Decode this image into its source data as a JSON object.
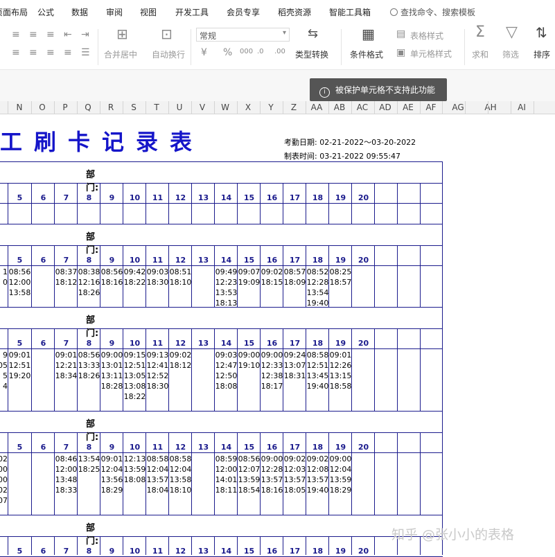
{
  "menu": [
    "页面布局",
    "公式",
    "数据",
    "审阅",
    "视图",
    "开发工具",
    "会员专享",
    "稻壳资源",
    "智能工具箱"
  ],
  "search_placeholder": "查找命令、搜索模板",
  "ribbon": {
    "merge_center": "合并居中",
    "auto_wrap": "自动换行",
    "number_format": "常规",
    "type_convert": "类型转换",
    "conditional_format": "条件格式",
    "table_style": "表格样式",
    "cell_style": "单元格样式",
    "sum": "求和",
    "filter": "筛选",
    "sort": "排序"
  },
  "toast": "被保护单元格不支持此功能",
  "columns": [
    "N",
    "O",
    "P",
    "Q",
    "R",
    "S",
    "T",
    "U",
    "V",
    "W",
    "X",
    "Y",
    "Z",
    "AA",
    "AB",
    "AC",
    "AD",
    "AE",
    "AF",
    "AG",
    "AH",
    "AI"
  ],
  "sheet": {
    "title": "工刷卡记录表",
    "period_label": "考勤日期:",
    "period_value": "02-21-2022～03-20-2022",
    "made_label": "制表时间:",
    "made_value": "03-21-2022 09:55:47",
    "dept_label": "部门:",
    "days": [
      "5",
      "6",
      "7",
      "8",
      "9",
      "10",
      "11",
      "12",
      "13",
      "14",
      "15",
      "16",
      "17",
      "18",
      "19",
      "20"
    ],
    "blocks": [
      {
        "cut": [],
        "cells": []
      },
      {
        "cut": [
          "1",
          "0"
        ],
        "cells": [
          [
            "08:56",
            "12:00",
            "13:58"
          ],
          [],
          [
            "08:37",
            "18:12"
          ],
          [
            "08:38",
            "12:16",
            "18:26"
          ],
          [
            "08:56",
            "18:16"
          ],
          [
            "09:42",
            "18:22"
          ],
          [
            "09:03",
            "18:30"
          ],
          [
            "08:51",
            "18:10"
          ],
          [],
          [
            "09:49",
            "12:23",
            "13:53",
            "18:13"
          ],
          [
            "09:07",
            "19:09"
          ],
          [
            "09:02",
            "18:15"
          ],
          [
            "08:57",
            "18:09"
          ],
          [
            "08:52",
            "12:28",
            "13:54",
            "19:40"
          ],
          [
            "08:25",
            "18:57"
          ],
          []
        ]
      },
      {
        "cut": [
          "9",
          "05",
          "5",
          "4"
        ],
        "cells": [
          [
            "09:01",
            "12:51",
            "19:20"
          ],
          [],
          [
            "09:01",
            "12:21",
            "18:34"
          ],
          [
            "08:56",
            "13:33",
            "18:26"
          ],
          [
            "09:00",
            "13:01",
            "13:11",
            "18:28"
          ],
          [
            "09:15",
            "12:51",
            "13:05",
            "13:08",
            "18:22"
          ],
          [
            "09:13",
            "12:41",
            "12:52",
            "18:30"
          ],
          [
            "09:02",
            "18:12"
          ],
          [],
          [
            "09:03",
            "12:47",
            "12:50",
            "18:08"
          ],
          [
            "09:00",
            "19:10"
          ],
          [
            "09:00",
            "12:33",
            "12:38",
            "18:17"
          ],
          [
            "09:24",
            "13:07",
            "18:31"
          ],
          [
            "08:58",
            "12:51",
            "13:45",
            "19:40"
          ],
          [
            "09:01",
            "12:26",
            "13:15",
            "18:58"
          ],
          []
        ]
      },
      {
        "cut": [
          "02",
          "00",
          "00",
          "02",
          "07"
        ],
        "cells": [
          [],
          [],
          [
            "08:46",
            "12:00",
            "13:48",
            "18:33"
          ],
          [
            "13:54",
            "18:25"
          ],
          [
            "09:01",
            "12:04",
            "13:56",
            "18:29"
          ],
          [
            "12:13",
            "13:59",
            "18:08"
          ],
          [
            "08:58",
            "12:04",
            "13:57",
            "18:04"
          ],
          [
            "08:58",
            "12:04",
            "13:58",
            "18:10"
          ],
          [],
          [
            "08:59",
            "12:00",
            "14:01",
            "18:11"
          ],
          [
            "08:56",
            "12:07",
            "13:59",
            "18:54"
          ],
          [
            "09:00",
            "12:28",
            "13:57",
            "18:16"
          ],
          [
            "09:02",
            "12:03",
            "13:57",
            "18:05"
          ],
          [
            "09:02",
            "12:08",
            "13:57",
            "19:40"
          ],
          [
            "09:00",
            "12:04",
            "13:59",
            "18:29"
          ],
          []
        ]
      },
      {
        "cut": [],
        "cells": []
      }
    ]
  },
  "watermark": "知乎 @张小小的表格"
}
